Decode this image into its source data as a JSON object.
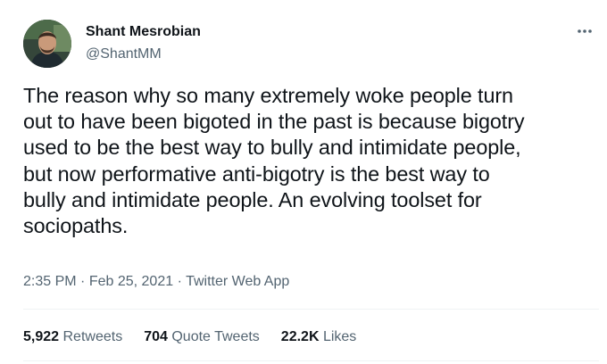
{
  "author": {
    "name": "Shant Mesrobian",
    "handle": "@ShantMM"
  },
  "tweet": {
    "text": "The reason why so many extremely woke people turn\nout to have been bigoted in the past is because bigotry\nused to be the best way to bully and intimidate people,\nbut now performative anti-bigotry is the best way to\nbully and intimidate people. An evolving toolset for\nsociopaths.",
    "time": "2:35 PM",
    "separator": "·",
    "date": "Feb 25, 2021",
    "source": "Twitter Web App"
  },
  "stats": {
    "retweets_count": "5,922",
    "retweets_label": "Retweets",
    "quotes_count": "704",
    "quotes_label": "Quote Tweets",
    "likes_count": "22.2K",
    "likes_label": "Likes"
  },
  "icons": {
    "more": "more-horizontal-icon"
  }
}
